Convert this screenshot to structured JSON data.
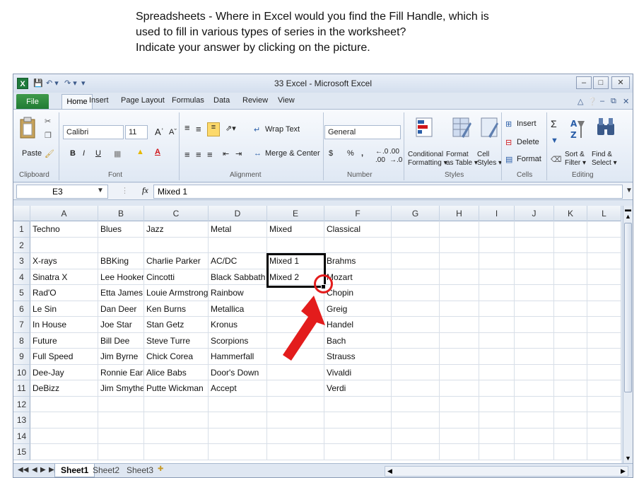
{
  "question": {
    "line1": "Spreadsheets - Where in Excel would you find the Fill Handle, which is",
    "line2": "used to fill in various types of series in the worksheet?",
    "line3": "Indicate your answer by clicking on the picture."
  },
  "window": {
    "title": "33 Excel - Microsoft Excel",
    "logo": "X"
  },
  "tabs": [
    "File",
    "Home",
    "Insert",
    "Page Layout",
    "Formulas",
    "Data",
    "Review",
    "View"
  ],
  "ribbon": {
    "clipboard": {
      "paste": "Paste",
      "group": "Clipboard"
    },
    "font": {
      "name": "Calibri",
      "size": "11",
      "bold": "B",
      "italic": "I",
      "underline": "U",
      "group": "Font"
    },
    "alignment": {
      "wrap_text": "Wrap Text",
      "merge_center": "Merge & Center",
      "group": "Alignment"
    },
    "number": {
      "format": "General",
      "currency": "$",
      "percent": "%",
      "comma": ",",
      "group": "Number"
    },
    "styles": {
      "conditional": "Conditional",
      "formatting": "Formatting",
      "format": "Format",
      "as_table": "as Table",
      "cell": "Cell",
      "cell_styles": "Styles",
      "group": "Styles"
    },
    "cells": {
      "insert": "Insert",
      "delete": "Delete",
      "format": "Format",
      "group": "Cells"
    },
    "editing": {
      "sigma": "Σ",
      "sort": "Sort &",
      "filter": "Filter",
      "find": "Find &",
      "select": "Select",
      "group": "Editing"
    }
  },
  "formula_bar": {
    "name_box": "E3",
    "fx": "fx",
    "formula": "Mixed 1"
  },
  "columns": [
    "A",
    "B",
    "C",
    "D",
    "E",
    "F",
    "G",
    "H",
    "I",
    "J",
    "K",
    "L"
  ],
  "row_numbers": [
    "1",
    "2",
    "3",
    "4",
    "5",
    "6",
    "7",
    "8",
    "9",
    "10",
    "11",
    "12",
    "13",
    "14",
    "15"
  ],
  "rows": [
    [
      "Techno",
      "Blues",
      "Jazz",
      "Metal",
      "Mixed",
      "Classical"
    ],
    [
      "",
      "",
      "",
      "",
      "",
      ""
    ],
    [
      "X-rays",
      "BBKing",
      "Charlie Parker",
      "AC/DC",
      "Mixed 1",
      "Brahms"
    ],
    [
      "Sinatra X",
      "Lee Hooker",
      "Cincotti",
      "Black Sabbath",
      "Mixed 2",
      "Mozart"
    ],
    [
      "Rad'O",
      "Etta James",
      "Louie Armstrong",
      "Rainbow",
      "",
      "Chopin"
    ],
    [
      "Le Sin",
      "Dan Deer",
      "Ken Burns",
      "Metallica",
      "",
      "Greig"
    ],
    [
      "In House",
      "Joe Star",
      "Stan Getz",
      "Kronus",
      "",
      "Handel"
    ],
    [
      "Future",
      "Bill Dee",
      "Steve Turre",
      "Scorpions",
      "",
      "Bach"
    ],
    [
      "Full Speed",
      "Jim Byrne",
      "Chick Corea",
      "Hammerfall",
      "",
      "Strauss"
    ],
    [
      "Dee-Jay",
      "Ronnie Earl",
      "Alice Babs",
      "Door's Down",
      "",
      "Vivaldi"
    ],
    [
      "DeBizz",
      "Jim Smythe",
      "Putte Wickman",
      "Accept",
      "",
      "Verdi"
    ]
  ],
  "sheets": [
    "Sheet1",
    "Sheet2",
    "Sheet3"
  ],
  "active_sheet": "Sheet1",
  "colors": {
    "annotation": "#e31c1c",
    "file_tab": "#1f7a32"
  }
}
